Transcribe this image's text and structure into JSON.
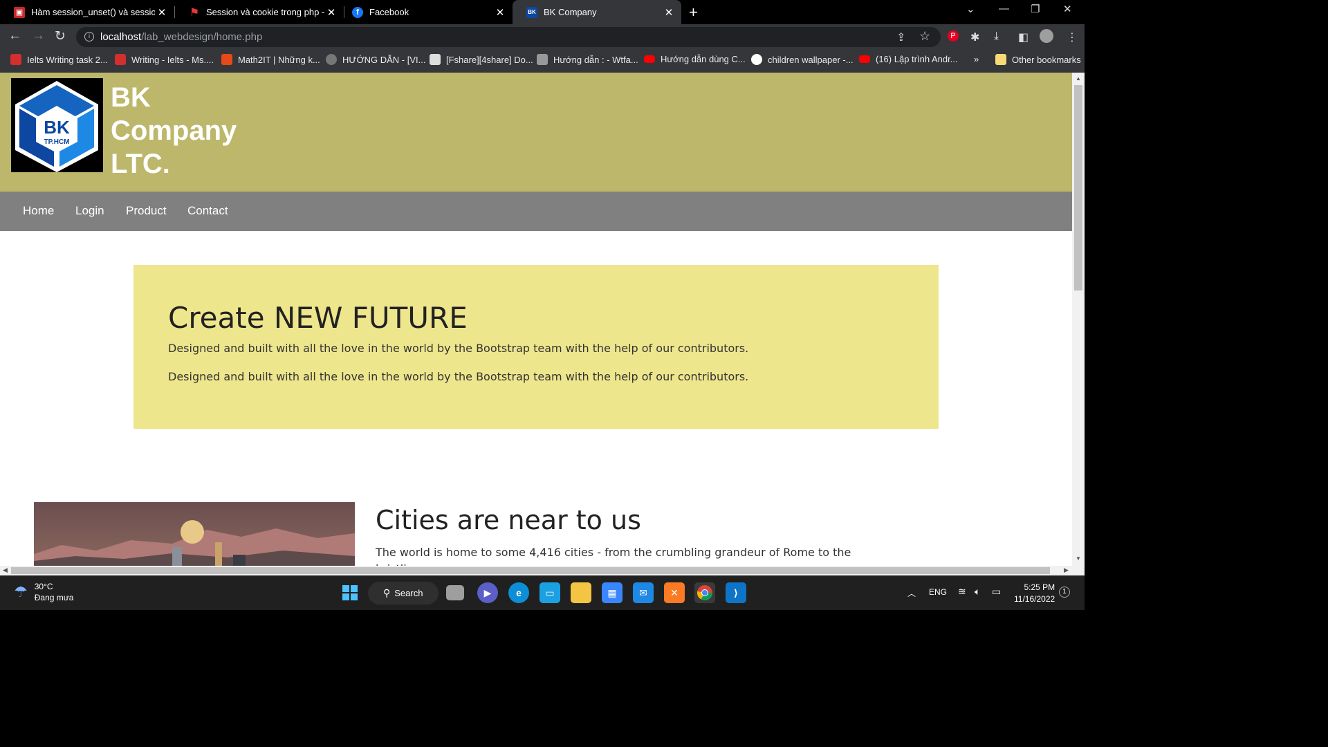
{
  "browser": {
    "tabs": [
      {
        "title": "Hàm session_unset() và session_d",
        "active": false
      },
      {
        "title": "Session và cookie trong php - Fre",
        "active": false
      },
      {
        "title": "Facebook",
        "active": false
      },
      {
        "title": "BK Company",
        "active": true
      }
    ],
    "url_host": "localhost",
    "url_path": "/lab_webdesign/home.php",
    "bookmarks": [
      "Ielts Writing task 2...",
      "Writing - Ielts - Ms....",
      "Math2IT | Những k...",
      "HƯỚNG DẪN - [VI...",
      "[Fshare][4share] Do...",
      "Hướng dẫn : - Wtfa...",
      "Hướng dẫn dùng C...",
      "children wallpaper -...",
      "(16) Lập trình Andr..."
    ],
    "bookmarks_more": "»",
    "other_bookmarks": "Other bookmarks"
  },
  "site": {
    "logo_text": "BK",
    "logo_subtext": "TP.HCM",
    "brand_line1": "BK",
    "brand_line2": "Company",
    "brand_line3": "LTC.",
    "nav": [
      "Home",
      "Login",
      "Product",
      "Contact"
    ],
    "hero_title": "Create NEW FUTURE",
    "hero_text_1": "Designed and built with all the love in the world by the Bootstrap team with the help of our contributors.",
    "hero_text_2": "Designed and built with all the love in the world by the Bootstrap team with the help of our contributors.",
    "section_title": "Cities are near to us",
    "section_text": "The world is home to some 4,416 cities - from the crumbling grandeur of Rome to the bristling,"
  },
  "taskbar": {
    "temperature": "30°C",
    "weather": "Đang mưa",
    "search_label": "Search",
    "language": "ENG",
    "time": "5:25 PM",
    "date": "11/16/2022",
    "notification_count": "1"
  },
  "colors": {
    "header_bg": "#bdb76b",
    "nav_bg": "#808080",
    "hero_bg": "#eee68c"
  }
}
